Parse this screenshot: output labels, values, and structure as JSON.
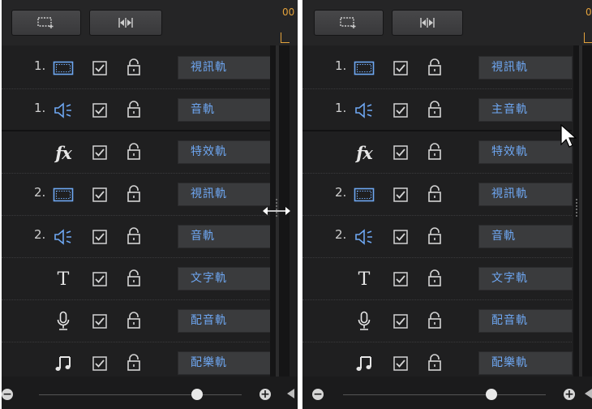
{
  "colors": {
    "accent_text": "#6ea7f2",
    "timecode": "#e3a23c",
    "panel_bg": "#1f1f20"
  },
  "panels": [
    {
      "toolbar": {
        "btn1_icon": "add-track-icon",
        "btn2_icon": "fit-timeline-icon"
      },
      "ruler_text": "00",
      "zoom_level": 0.78,
      "tracks": [
        {
          "number": "1.",
          "icon": "video-track-icon",
          "checked": true,
          "locked": false,
          "name": "視訊軌"
        },
        {
          "number": "1.",
          "icon": "audio-track-icon",
          "checked": true,
          "locked": false,
          "name": "音軌"
        },
        {
          "number": "",
          "icon": "fx-icon",
          "icon_text": "fx",
          "checked": true,
          "locked": false,
          "name": "特效軌"
        },
        {
          "number": "2.",
          "icon": "video-track-icon",
          "checked": true,
          "locked": false,
          "name": "視訊軌"
        },
        {
          "number": "2.",
          "icon": "audio-track-icon",
          "checked": true,
          "locked": false,
          "name": "音軌"
        },
        {
          "number": "",
          "icon": "title-icon",
          "icon_text": "T",
          "checked": true,
          "locked": false,
          "name": "文字軌"
        },
        {
          "number": "",
          "icon": "microphone-icon",
          "checked": true,
          "locked": false,
          "name": "配音軌"
        },
        {
          "number": "",
          "icon": "music-note-icon",
          "checked": true,
          "locked": false,
          "name": "配樂軌"
        }
      ]
    },
    {
      "toolbar": {
        "btn1_icon": "add-track-icon",
        "btn2_icon": "fit-timeline-icon"
      },
      "ruler_text": "0",
      "zoom_level": 0.73,
      "tracks": [
        {
          "number": "1.",
          "icon": "video-track-icon",
          "checked": true,
          "locked": false,
          "name": "視訊軌"
        },
        {
          "number": "1.",
          "icon": "audio-track-icon",
          "checked": true,
          "locked": false,
          "name": "主音軌"
        },
        {
          "number": "",
          "icon": "fx-icon",
          "icon_text": "fx",
          "checked": true,
          "locked": false,
          "name": "特效軌"
        },
        {
          "number": "2.",
          "icon": "video-track-icon",
          "checked": true,
          "locked": false,
          "name": "視訊軌"
        },
        {
          "number": "2.",
          "icon": "audio-track-icon",
          "checked": true,
          "locked": false,
          "name": "音軌"
        },
        {
          "number": "",
          "icon": "title-icon",
          "icon_text": "T",
          "checked": true,
          "locked": false,
          "name": "文字軌"
        },
        {
          "number": "",
          "icon": "microphone-icon",
          "checked": true,
          "locked": false,
          "name": "配音軌"
        },
        {
          "number": "",
          "icon": "music-note-icon",
          "checked": true,
          "locked": false,
          "name": "配樂軌"
        }
      ]
    }
  ]
}
